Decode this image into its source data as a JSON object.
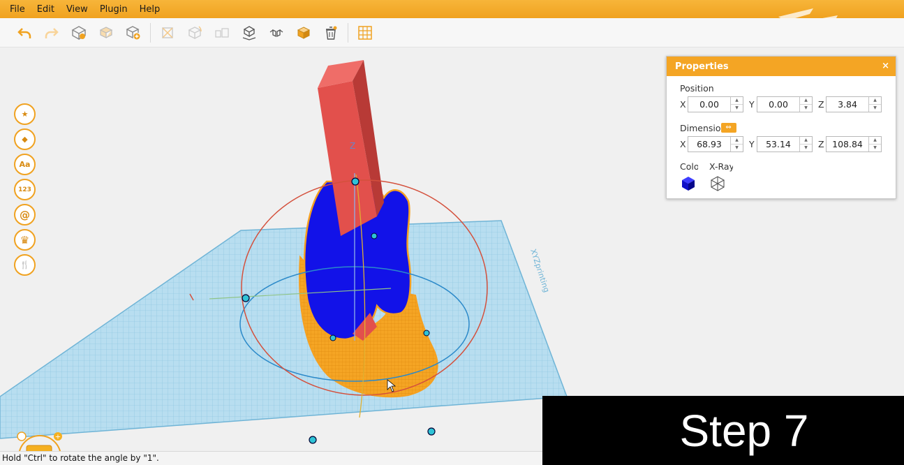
{
  "menu": [
    "File",
    "Edit",
    "View",
    "Plugin",
    "Help"
  ],
  "toolbar": {
    "icons": [
      "undo-icon",
      "redo-icon",
      "import-model-icon",
      "duplicate-model-icon",
      "add-model-icon",
      "move-icon",
      "rotate-icon",
      "scale-icon",
      "place-on-bed-icon",
      "mirror-icon",
      "color-box-icon",
      "delete-icon",
      "grid-icon"
    ]
  },
  "side_tools": [
    {
      "icon": "star-icon",
      "glyph": "★"
    },
    {
      "icon": "shape-icon",
      "glyph": "◆"
    },
    {
      "icon": "text-icon",
      "glyph": "Aa"
    },
    {
      "icon": "number-icon",
      "glyph": "123"
    },
    {
      "icon": "at-sign-icon",
      "glyph": "@"
    },
    {
      "icon": "crown-icon",
      "glyph": "♛"
    },
    {
      "icon": "utensils-icon",
      "glyph": "🍴"
    }
  ],
  "properties": {
    "title": "Properties",
    "close": "×",
    "position_label": "Position",
    "position": {
      "x": "0.00",
      "y": "0.00",
      "z": "3.84"
    },
    "dimension_label": "Dimensio",
    "dimension": {
      "x": "68.93",
      "y": "53.14",
      "z": "108.84"
    },
    "color_label": "Colo",
    "xray_label": "X-Ray",
    "axis_x": "X",
    "axis_y": "Y",
    "axis_z": "Z"
  },
  "scene": {
    "bed_label": "XYZprinting",
    "z_axis_label": "Z",
    "model_color": "#1010e0",
    "selection_color": "#f5a020",
    "bed_color": "#9fd0e8"
  },
  "status_text": "Hold \"Ctrl\" to rotate the angle by \"1\".",
  "overlay_text": "Step 7"
}
